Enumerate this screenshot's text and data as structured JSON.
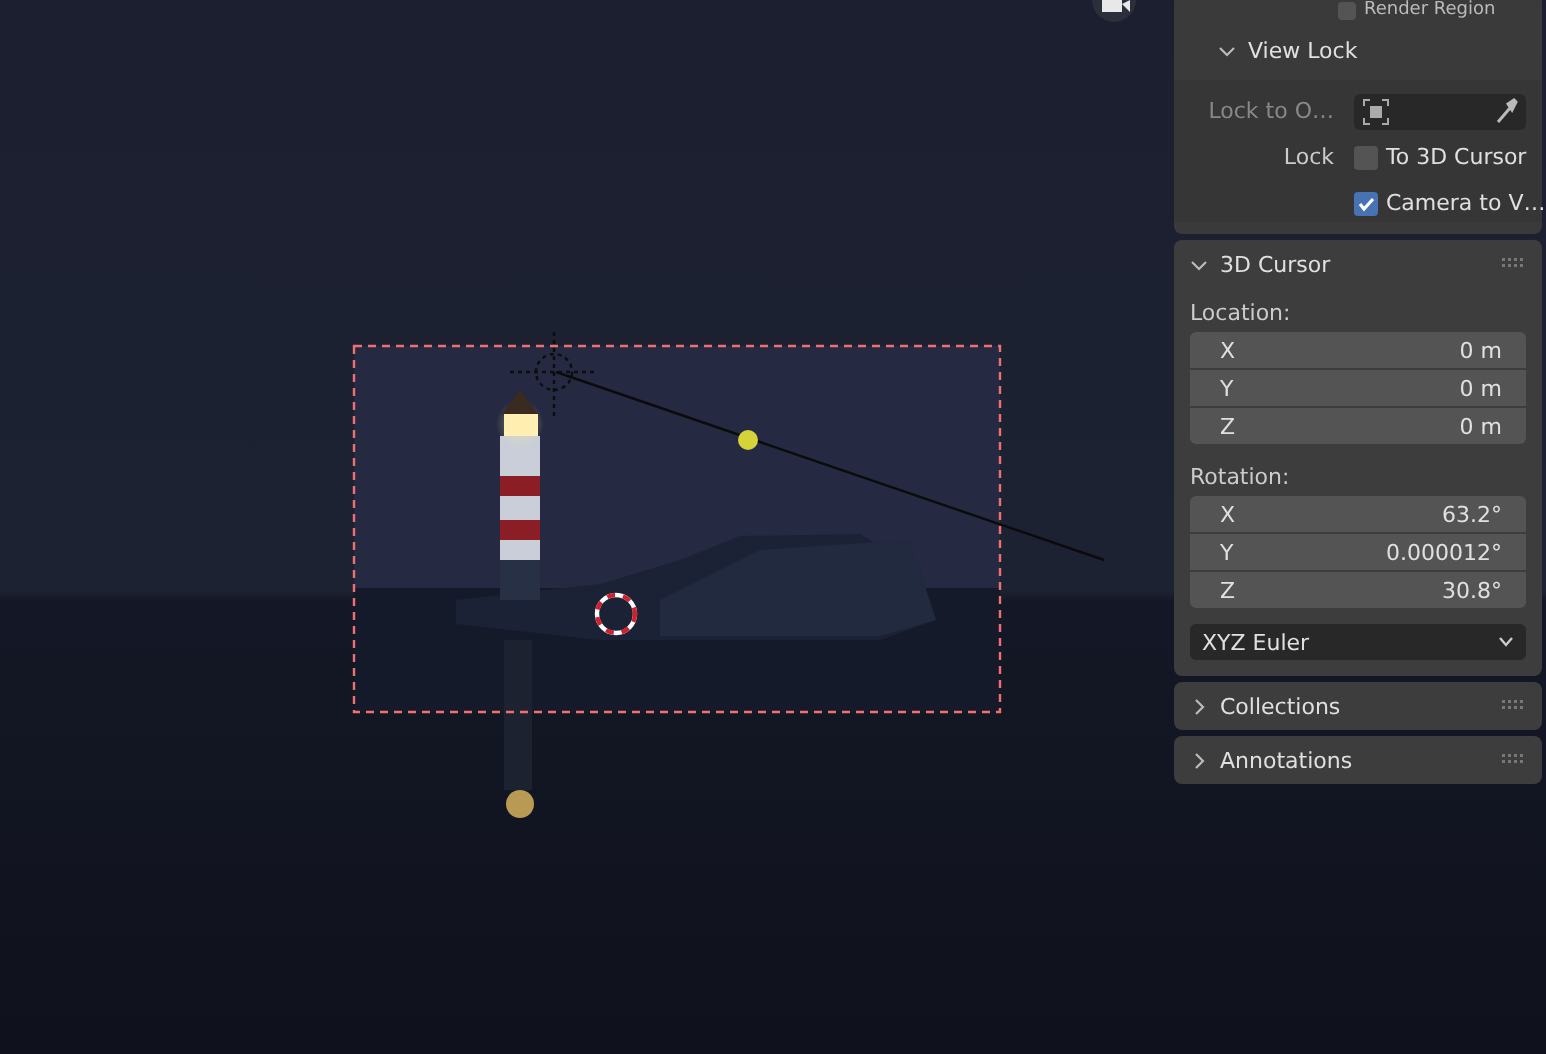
{
  "render_region": {
    "label": "Render Region",
    "checked": false
  },
  "view_lock": {
    "title": "View Lock",
    "expanded": true,
    "lock_to_object": {
      "label": "Lock to O…"
    },
    "lock_label": "Lock",
    "options": [
      {
        "label": "To 3D Cursor",
        "checked": false
      },
      {
        "label": "Camera to V…",
        "checked": true
      }
    ]
  },
  "cursor_3d": {
    "title": "3D Cursor",
    "expanded": true,
    "location_label": "Location:",
    "location": [
      {
        "axis": "X",
        "value": "0 m"
      },
      {
        "axis": "Y",
        "value": "0 m"
      },
      {
        "axis": "Z",
        "value": "0 m"
      }
    ],
    "rotation_label": "Rotation:",
    "rotation": [
      {
        "axis": "X",
        "value": "63.2°"
      },
      {
        "axis": "Y",
        "value": "0.000012°"
      },
      {
        "axis": "Z",
        "value": "30.8°"
      }
    ],
    "rotation_mode": "XYZ Euler"
  },
  "collapsed_panels": [
    {
      "title": "Collections",
      "expanded": false
    },
    {
      "title": "Annotations",
      "expanded": false
    }
  ]
}
